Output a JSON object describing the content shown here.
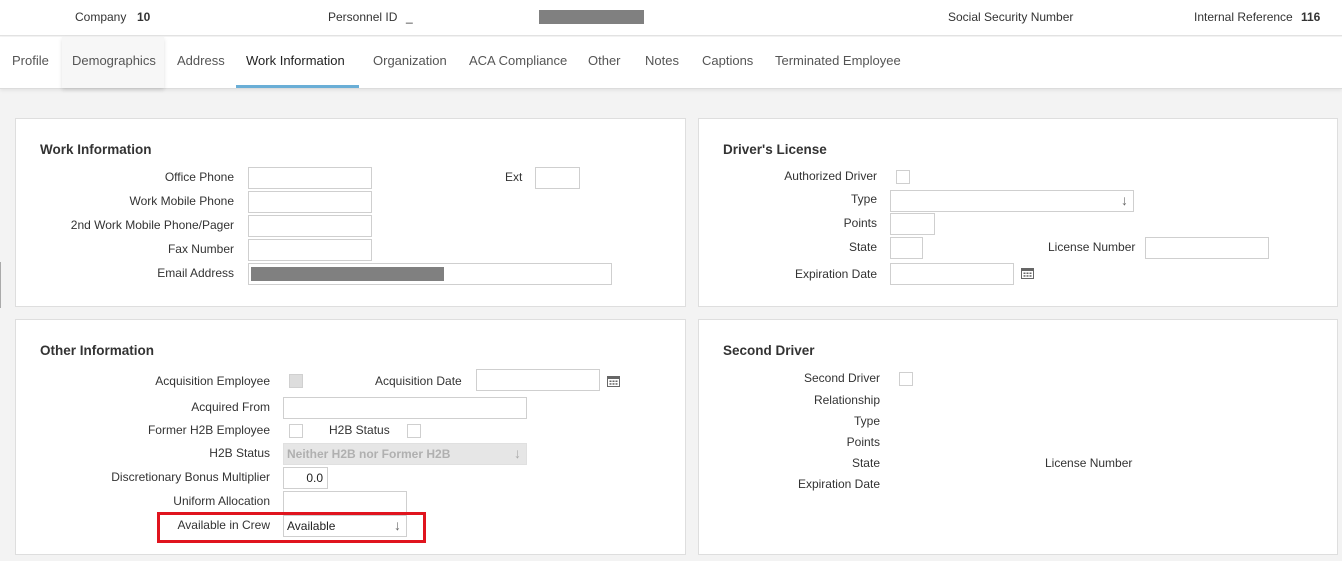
{
  "header": {
    "company_label": "Company",
    "company_value": "10",
    "personnel_label": "Personnel ID",
    "personnel_value": "_",
    "ssn_label": "Social Security Number",
    "internal_ref_label": "Internal Reference",
    "internal_ref_value": "116"
  },
  "tabs": [
    {
      "label": "Profile"
    },
    {
      "label": "Demographics"
    },
    {
      "label": "Address"
    },
    {
      "label": "Work Information"
    },
    {
      "label": "Organization"
    },
    {
      "label": "ACA Compliance"
    },
    {
      "label": "Other"
    },
    {
      "label": "Notes"
    },
    {
      "label": "Captions"
    },
    {
      "label": "Terminated Employee"
    }
  ],
  "active_tab": "Work Information",
  "work_info": {
    "title": "Work Information",
    "office_phone": "Office Phone",
    "ext": "Ext",
    "work_mobile": "Work Mobile Phone",
    "second_mobile": "2nd Work Mobile Phone/Pager",
    "fax": "Fax Number",
    "email": "Email Address"
  },
  "drivers_license": {
    "title": "Driver's License",
    "authorized": "Authorized Driver",
    "type": "Type",
    "points": "Points",
    "state": "State",
    "license_number": "License Number",
    "expiration": "Expiration Date"
  },
  "other_info": {
    "title": "Other Information",
    "acq_employee": "Acquisition Employee",
    "acq_date": "Acquisition Date",
    "acquired_from": "Acquired From",
    "former_h2b": "Former H2B Employee",
    "h2b_status_chk": "H2B Status",
    "h2b_status": "H2B Status",
    "h2b_status_value": "Neither H2B nor Former H2B",
    "bonus_multiplier": "Discretionary Bonus Multiplier",
    "bonus_multiplier_value": "0.0",
    "uniform_allocation": "Uniform Allocation",
    "available_in_crew": "Available in Crew",
    "available_in_crew_value": "Available"
  },
  "second_driver": {
    "title": "Second Driver",
    "second_driver": "Second Driver",
    "relationship": "Relationship",
    "type": "Type",
    "points": "Points",
    "state": "State",
    "license_number": "License Number",
    "expiration": "Expiration Date"
  },
  "colors": {
    "active_tab_underline": "#6aaed6",
    "highlight": "#e0141e",
    "redaction": "#808080"
  }
}
